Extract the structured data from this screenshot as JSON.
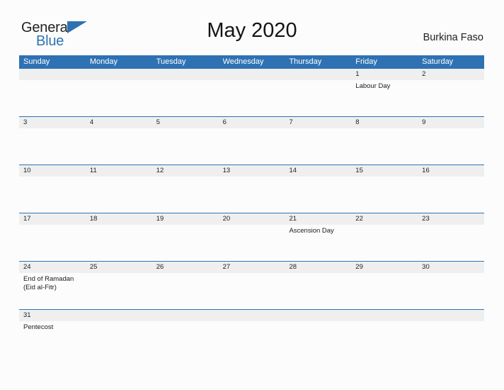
{
  "brand": {
    "name_part1": "General",
    "name_part2": "Blue",
    "flag_icon": "blue-triangle-flag",
    "primary_color": "#2e72b3"
  },
  "header": {
    "title": "May 2020",
    "region": "Burkina Faso"
  },
  "calendar": {
    "weekdays": [
      "Sunday",
      "Monday",
      "Tuesday",
      "Wednesday",
      "Thursday",
      "Friday",
      "Saturday"
    ],
    "weeks": [
      {
        "days": [
          {
            "number": "",
            "events": []
          },
          {
            "number": "",
            "events": []
          },
          {
            "number": "",
            "events": []
          },
          {
            "number": "",
            "events": []
          },
          {
            "number": "",
            "events": []
          },
          {
            "number": "1",
            "events": [
              "Labour Day"
            ]
          },
          {
            "number": "2",
            "events": []
          }
        ]
      },
      {
        "days": [
          {
            "number": "3",
            "events": []
          },
          {
            "number": "4",
            "events": []
          },
          {
            "number": "5",
            "events": []
          },
          {
            "number": "6",
            "events": []
          },
          {
            "number": "7",
            "events": []
          },
          {
            "number": "8",
            "events": []
          },
          {
            "number": "9",
            "events": []
          }
        ]
      },
      {
        "days": [
          {
            "number": "10",
            "events": []
          },
          {
            "number": "11",
            "events": []
          },
          {
            "number": "12",
            "events": []
          },
          {
            "number": "13",
            "events": []
          },
          {
            "number": "14",
            "events": []
          },
          {
            "number": "15",
            "events": []
          },
          {
            "number": "16",
            "events": []
          }
        ]
      },
      {
        "days": [
          {
            "number": "17",
            "events": []
          },
          {
            "number": "18",
            "events": []
          },
          {
            "number": "19",
            "events": []
          },
          {
            "number": "20",
            "events": []
          },
          {
            "number": "21",
            "events": [
              "Ascension Day"
            ]
          },
          {
            "number": "22",
            "events": []
          },
          {
            "number": "23",
            "events": []
          }
        ]
      },
      {
        "days": [
          {
            "number": "24",
            "events": [
              "End of Ramadan",
              "(Eid al-Fitr)"
            ]
          },
          {
            "number": "25",
            "events": []
          },
          {
            "number": "26",
            "events": []
          },
          {
            "number": "27",
            "events": []
          },
          {
            "number": "28",
            "events": []
          },
          {
            "number": "29",
            "events": []
          },
          {
            "number": "30",
            "events": []
          }
        ]
      },
      {
        "short": true,
        "days": [
          {
            "number": "31",
            "events": [
              "Pentecost"
            ]
          },
          {
            "number": "",
            "events": []
          },
          {
            "number": "",
            "events": []
          },
          {
            "number": "",
            "events": []
          },
          {
            "number": "",
            "events": []
          },
          {
            "number": "",
            "events": []
          },
          {
            "number": "",
            "events": []
          }
        ]
      }
    ]
  }
}
